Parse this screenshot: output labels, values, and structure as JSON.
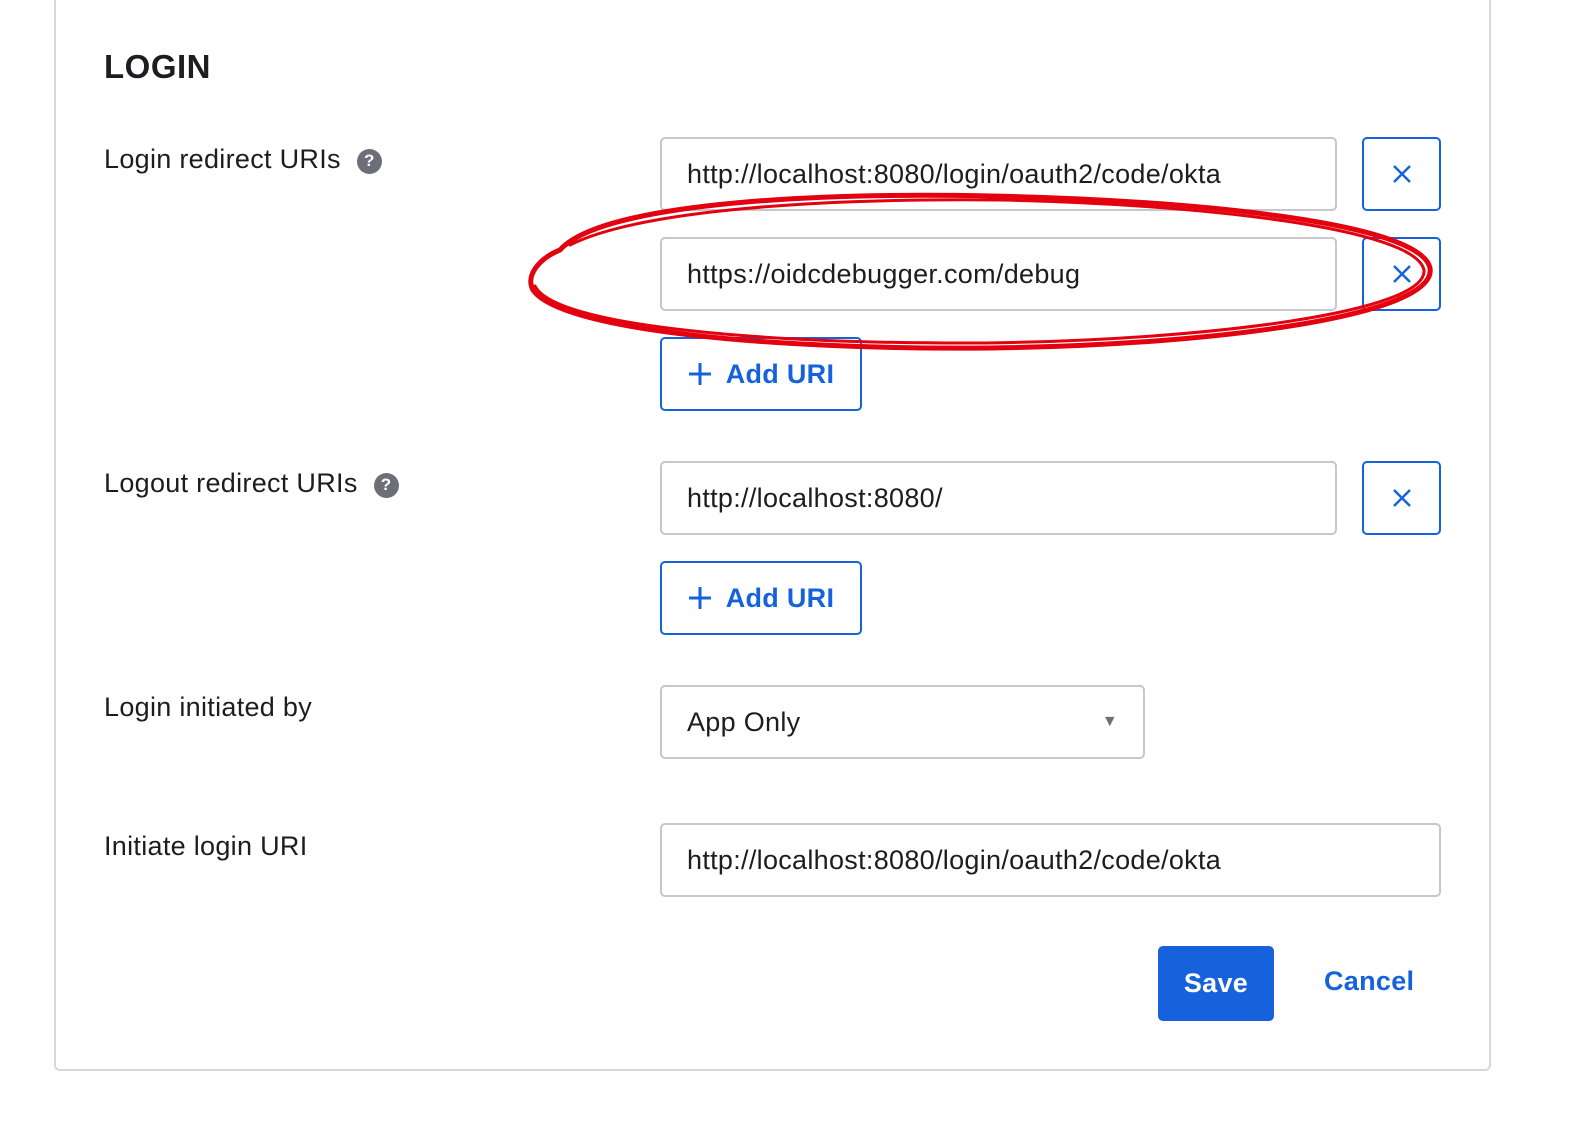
{
  "section": {
    "title": "LOGIN"
  },
  "login_redirect": {
    "label": "Login redirect URIs",
    "help": "?",
    "uris": [
      "http://localhost:8080/login/oauth2/code/okta",
      "https://oidcdebugger.com/debug"
    ],
    "add_label": "Add URI"
  },
  "logout_redirect": {
    "label": "Logout redirect URIs",
    "help": "?",
    "uris": [
      "http://localhost:8080/"
    ],
    "add_label": "Add URI"
  },
  "login_initiated": {
    "label": "Login initiated by",
    "selected": "App Only"
  },
  "initiate_uri": {
    "label": "Initiate login URI",
    "value": "http://localhost:8080/login/oauth2/code/okta"
  },
  "actions": {
    "save_label": "Save",
    "cancel_label": "Cancel"
  },
  "icons": {
    "remove": "close-icon",
    "add": "plus-icon",
    "help": "help-icon",
    "dropdown": "caret-down-icon"
  },
  "colors": {
    "accent": "#1662dd",
    "annotation": "#e3000f",
    "border": "#c6c6cd"
  }
}
